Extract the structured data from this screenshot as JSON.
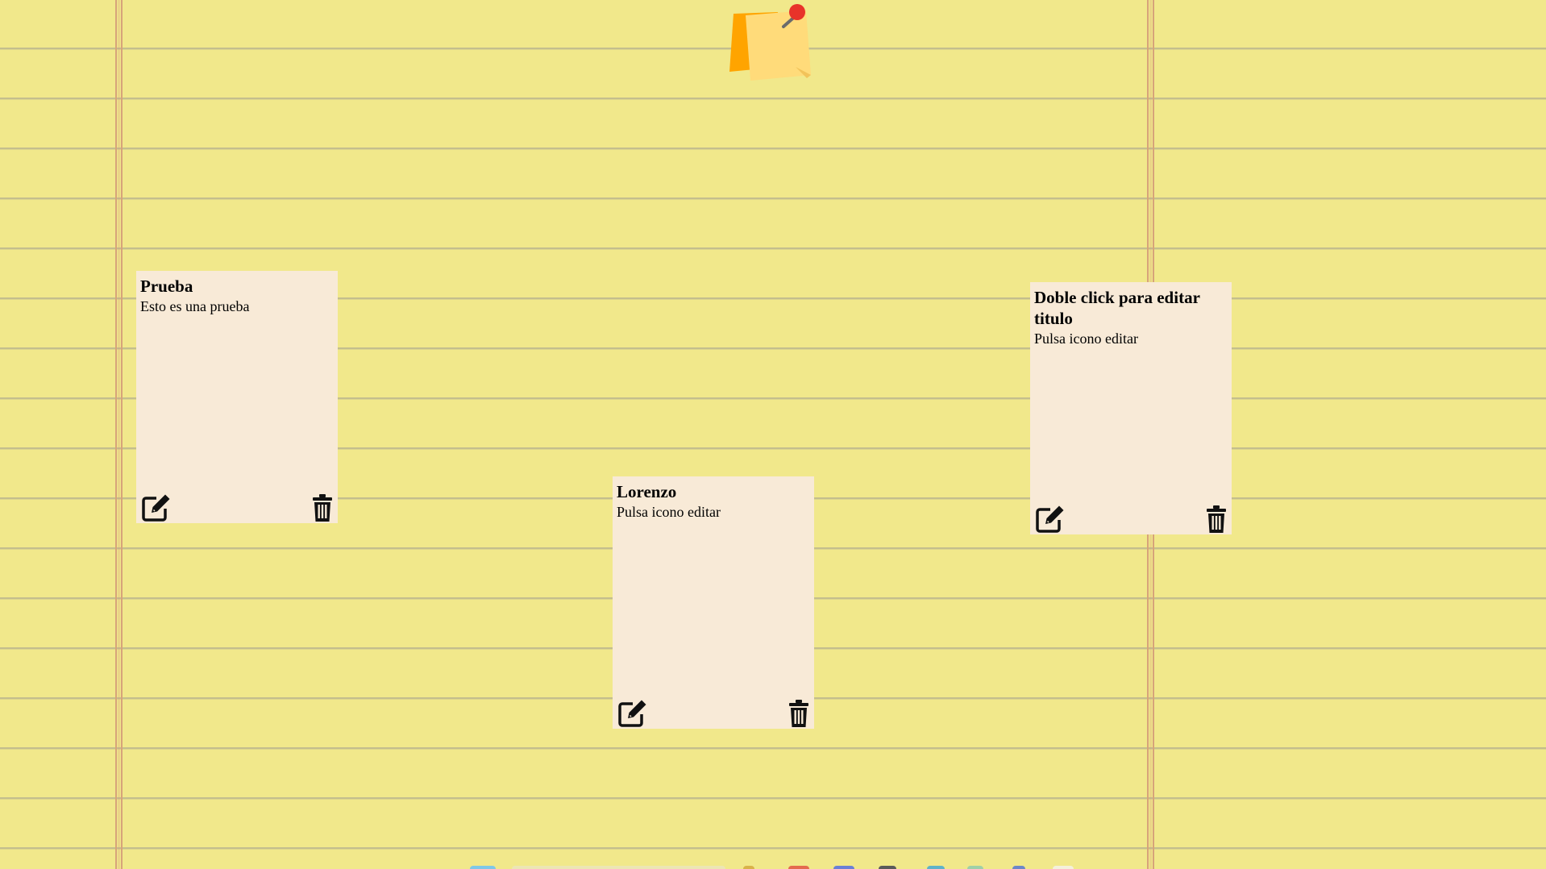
{
  "app": {
    "logo_icon": "sticky-note-pin-icon"
  },
  "notes": [
    {
      "title": "Prueba",
      "body": "Esto es una prueba",
      "edit_icon": "edit-icon",
      "delete_icon": "trash-icon"
    },
    {
      "title": "Lorenzo",
      "body": "Pulsa icono editar",
      "edit_icon": "edit-icon",
      "delete_icon": "trash-icon"
    },
    {
      "title": "Doble click para editar titulo",
      "body": "Pulsa icono editar",
      "edit_icon": "edit-icon",
      "delete_icon": "trash-icon"
    }
  ],
  "colors": {
    "background": "#f1e88b",
    "rule_line": "#bfb98a",
    "margin_line": "#d7a37a",
    "note_background": "#f8ead7",
    "logo_orange": "#ffa500",
    "logo_yellow": "#ffd966",
    "pin_red": "#e8332a"
  }
}
